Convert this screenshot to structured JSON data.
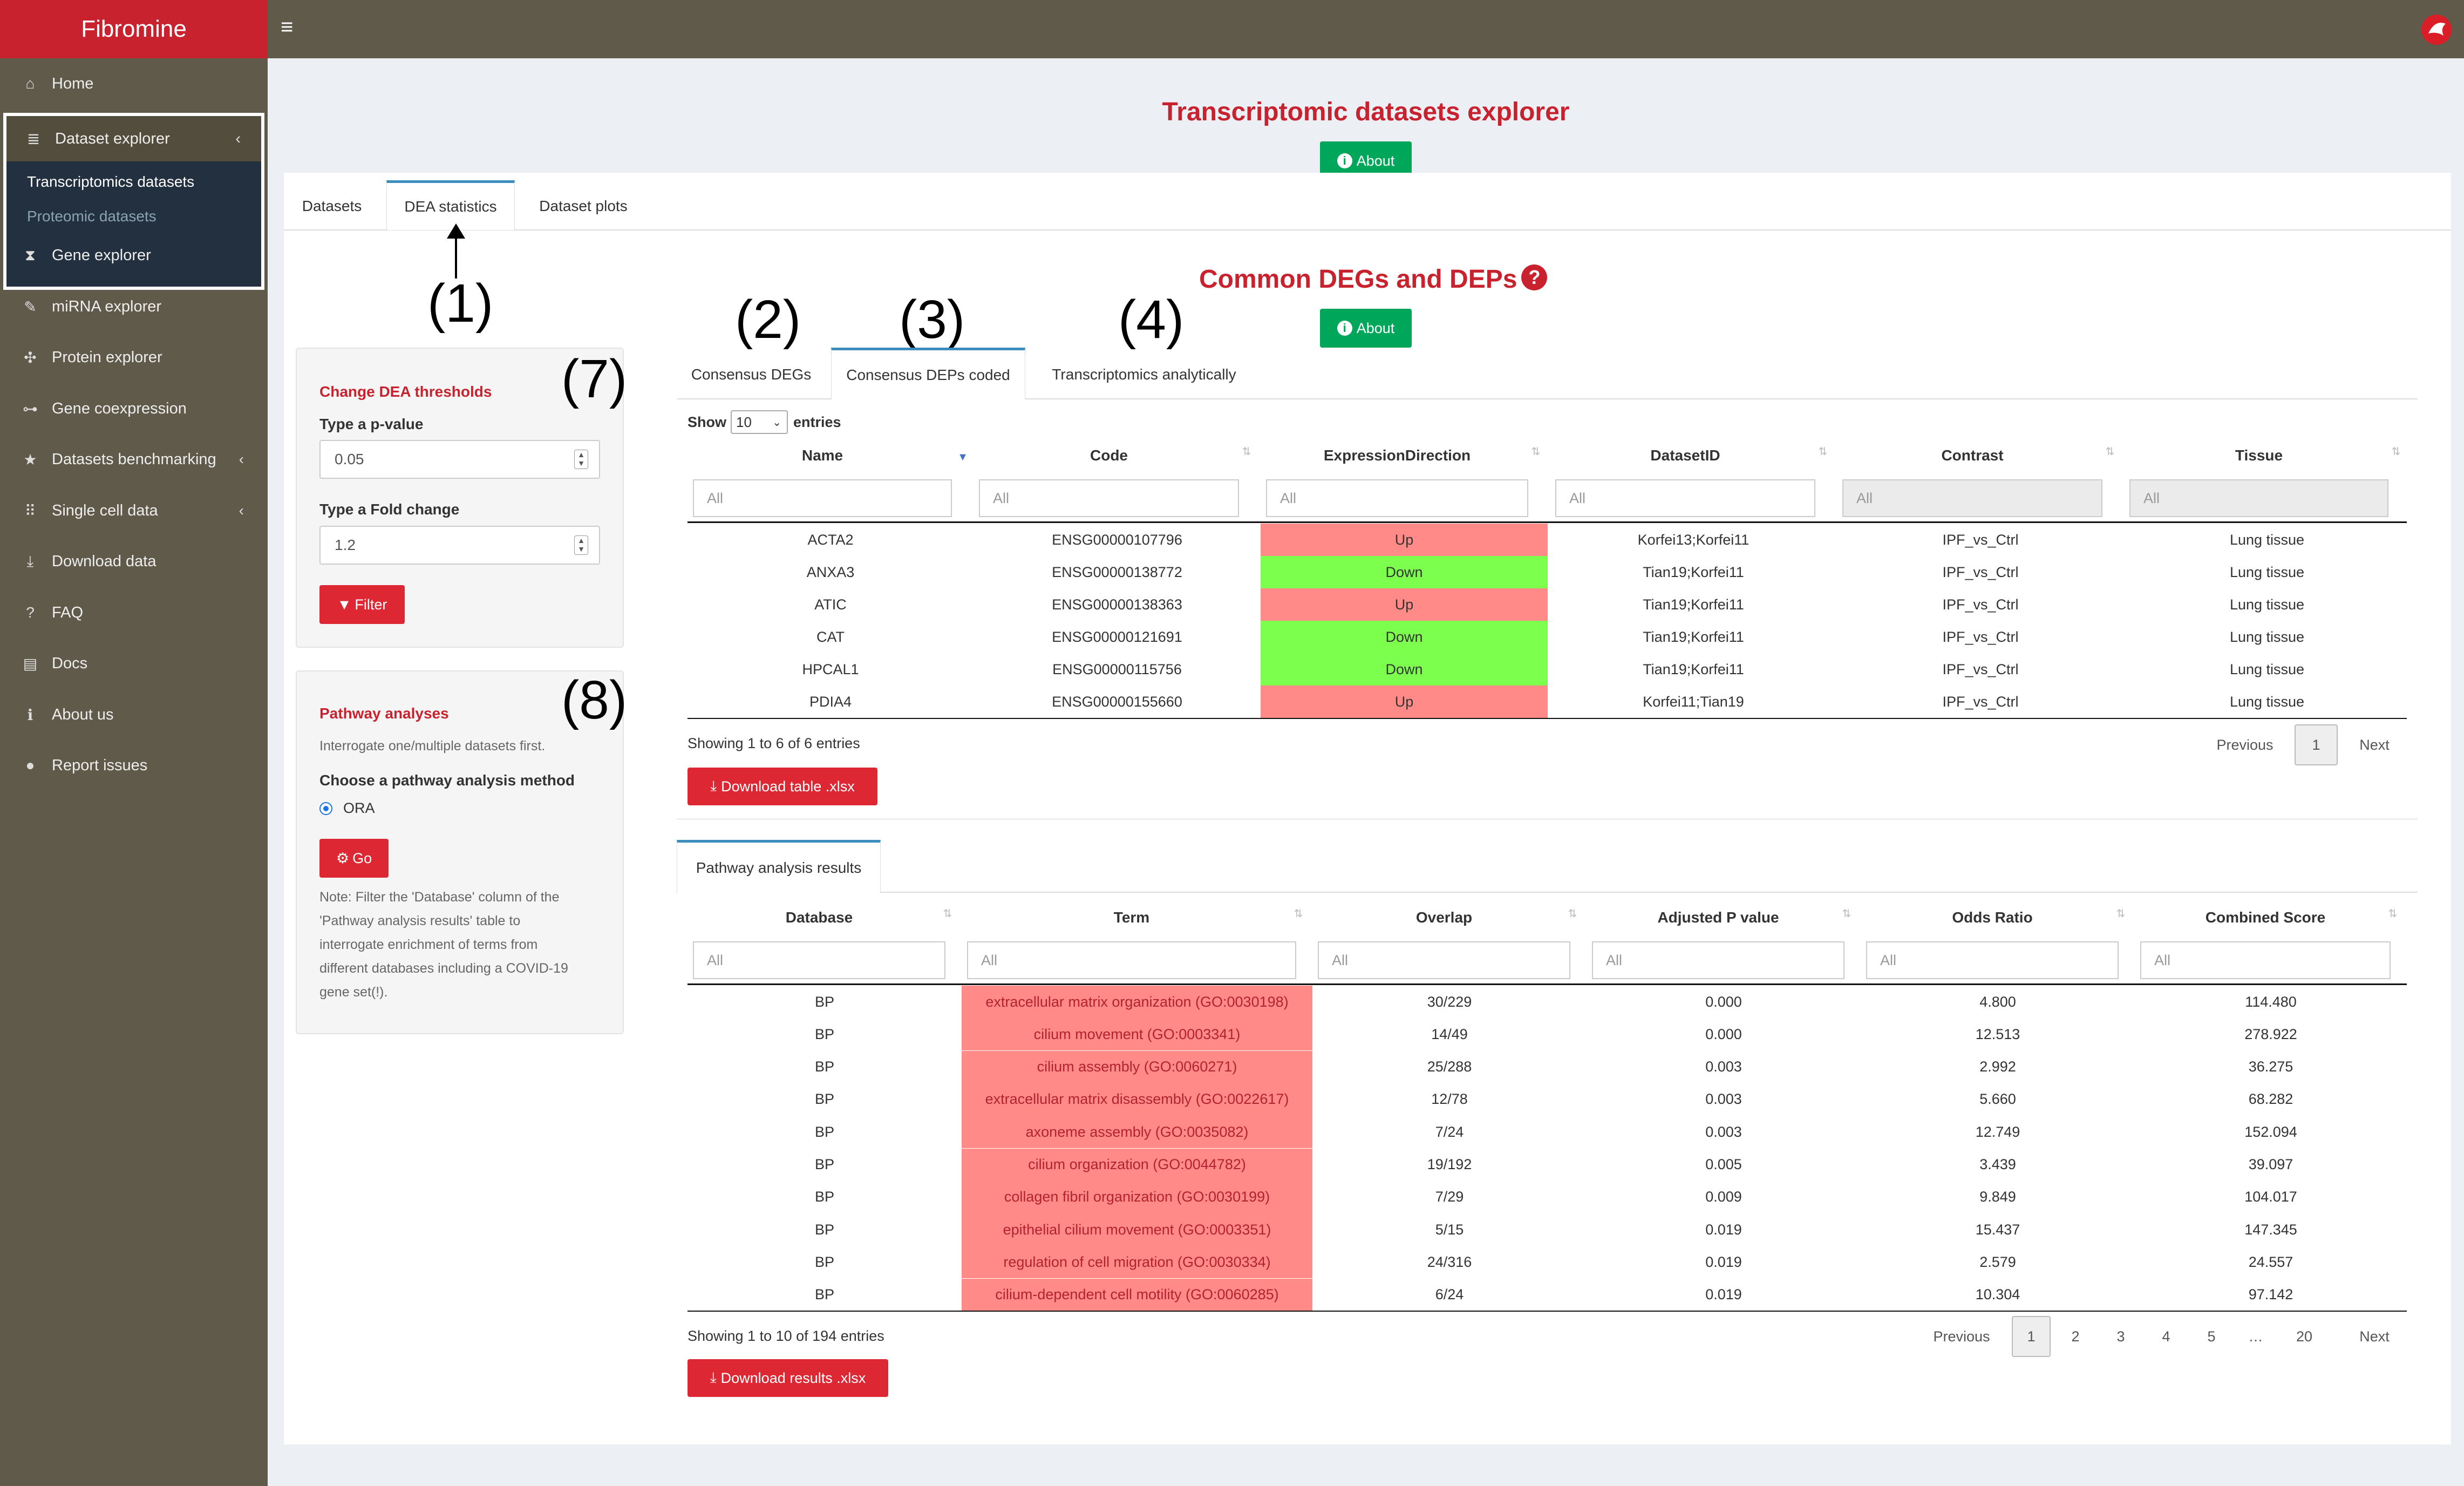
{
  "app": {
    "title": "Fibromine"
  },
  "sidebar": {
    "home": "Home",
    "dataset_explorer": "Dataset explorer",
    "transcriptomics": "Transcriptomics datasets",
    "proteomic": "Proteomic datasets",
    "items": [
      "Gene explorer",
      "miRNA explorer",
      "Protein explorer",
      "Gene coexpression",
      "Datasets benchmarking",
      "Single cell data",
      "Download data",
      "FAQ",
      "Docs",
      "About us",
      "Report issues"
    ]
  },
  "main": {
    "title": "Transcriptomic datasets explorer",
    "about": "About",
    "tabs": [
      "Datasets",
      "DEA statistics",
      "Dataset plots"
    ]
  },
  "annotations": [
    "(1)",
    "(2)",
    "(3)",
    "(4)",
    "(7)",
    "(8)"
  ],
  "thresholds": {
    "title": "Change DEA thresholds",
    "pvalue_label": "Type a p-value",
    "pvalue": "0.05",
    "fc_label": "Type a Fold change",
    "fc": "1.2",
    "filter_btn": "Filter"
  },
  "pathway": {
    "title": "Pathway analyses",
    "hint": "Interrogate one/multiple datasets first.",
    "method_label": "Choose a pathway analysis method",
    "method": "ORA",
    "go_btn": "Go",
    "note": [
      "Note: Filter the 'Database' column of the",
      "'Pathway analysis results' table to",
      "interrogate enrichment of terms from",
      "different databases including a COVID-19",
      "gene set(!)."
    ]
  },
  "common": {
    "title": "Common DEGs and DEPs",
    "about": "About",
    "tabs": [
      "Consensus DEGs",
      "Consensus DEPs coded",
      "Transcriptomics analytically"
    ],
    "show": "Show",
    "entries_value": "10",
    "entries": "entries",
    "columns": [
      "Name",
      "Code",
      "ExpressionDirection",
      "DatasetID",
      "Contrast",
      "Tissue"
    ],
    "filter_placeholder": "All",
    "rows": [
      [
        "ACTA2",
        "ENSG00000107796",
        "Up",
        "Korfei13;Korfei11",
        "IPF_vs_Ctrl",
        "Lung tissue"
      ],
      [
        "ANXA3",
        "ENSG00000138772",
        "Down",
        "Tian19;Korfei11",
        "IPF_vs_Ctrl",
        "Lung tissue"
      ],
      [
        "ATIC",
        "ENSG00000138363",
        "Up",
        "Tian19;Korfei11",
        "IPF_vs_Ctrl",
        "Lung tissue"
      ],
      [
        "CAT",
        "ENSG00000121691",
        "Down",
        "Tian19;Korfei11",
        "IPF_vs_Ctrl",
        "Lung tissue"
      ],
      [
        "HPCAL1",
        "ENSG00000115756",
        "Down",
        "Tian19;Korfei11",
        "IPF_vs_Ctrl",
        "Lung tissue"
      ],
      [
        "PDIA4",
        "ENSG00000155660",
        "Up",
        "Korfei11;Tian19",
        "IPF_vs_Ctrl",
        "Lung tissue"
      ]
    ],
    "info": "Showing 1 to 6 of 6 entries",
    "previous": "Previous",
    "page": "1",
    "next": "Next",
    "download": "Download table .xlsx",
    "colors": {
      "up": "#ff8a87",
      "down": "#7cff4d"
    }
  },
  "pathway_results": {
    "tab": "Pathway analysis results",
    "columns": [
      "Database",
      "Term",
      "Overlap",
      "Adjusted P value",
      "Odds Ratio",
      "Combined Score"
    ],
    "filter_placeholder": "All",
    "rows": [
      [
        "BP",
        "extracellular matrix organization (GO:0030198)",
        "30/229",
        "0.000",
        "4.800",
        "114.480"
      ],
      [
        "BP",
        "cilium movement (GO:0003341)",
        "14/49",
        "0.000",
        "12.513",
        "278.922"
      ],
      [
        "BP",
        "cilium assembly (GO:0060271)",
        "25/288",
        "0.003",
        "2.992",
        "36.275"
      ],
      [
        "BP",
        "extracellular matrix disassembly (GO:0022617)",
        "12/78",
        "0.003",
        "5.660",
        "68.282"
      ],
      [
        "BP",
        "axoneme assembly (GO:0035082)",
        "7/24",
        "0.003",
        "12.749",
        "152.094"
      ],
      [
        "BP",
        "cilium organization (GO:0044782)",
        "19/192",
        "0.005",
        "3.439",
        "39.097"
      ],
      [
        "BP",
        "collagen fibril organization (GO:0030199)",
        "7/29",
        "0.009",
        "9.849",
        "104.017"
      ],
      [
        "BP",
        "epithelial cilium movement (GO:0003351)",
        "5/15",
        "0.019",
        "15.437",
        "147.345"
      ],
      [
        "BP",
        "regulation of cell migration (GO:0030334)",
        "24/316",
        "0.019",
        "2.579",
        "24.557"
      ],
      [
        "BP",
        "cilium-dependent cell motility (GO:0060285)",
        "6/24",
        "0.019",
        "10.304",
        "97.142"
      ]
    ],
    "info": "Showing 1 to 10 of 194 entries",
    "previous": "Previous",
    "pages": [
      "1",
      "2",
      "3",
      "4",
      "5",
      "…",
      "20"
    ],
    "next": "Next",
    "download": "Download results .xlsx",
    "term_color": "#ff8a87"
  }
}
